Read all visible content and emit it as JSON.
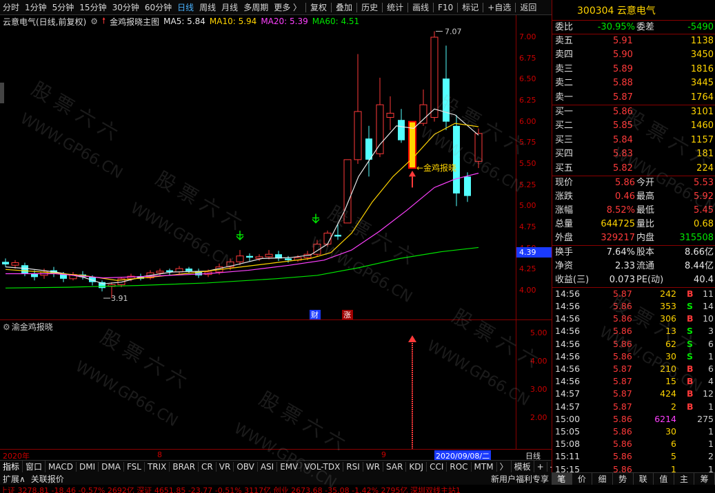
{
  "toolbar": {
    "periods": [
      "分时",
      "1分钟",
      "5分钟",
      "15分钟",
      "30分钟",
      "60分钟",
      "日线",
      "周线",
      "月线",
      "多周期",
      "更多 〉"
    ],
    "active_period": "日线",
    "tools": [
      "复权",
      "叠加",
      "历史",
      "统计",
      "画线",
      "F10",
      "标记",
      "+自选",
      "返回"
    ]
  },
  "chart_header": {
    "stock_label": "云意电气(日线,前复权)",
    "indicator_name": "金鸡报晓主图",
    "ma5": "MA5: 5.84",
    "ma10": "MA10: 5.94",
    "ma20": "MA20: 5.39",
    "ma60": "MA60: 4.51"
  },
  "price_axis": [
    "7.00",
    "6.75",
    "6.50",
    "6.25",
    "6.00",
    "5.75",
    "5.50",
    "5.25",
    "5.00",
    "4.75",
    "4.50",
    "4.25",
    "4.00"
  ],
  "current_price_tag": "4.39",
  "annotations": {
    "high_label": "7.07",
    "low_label": "3.91",
    "signal_label": "←金鸡报晓",
    "cai": "财",
    "zhang": "涨"
  },
  "sub_chart": {
    "title": "渝金鸡报晓",
    "axis": [
      "5.00",
      "4.00",
      "3.00",
      "2.00"
    ]
  },
  "date_axis": {
    "start": "2020年",
    "m8": "8",
    "m9": "9",
    "cursor_date": "2020/09/08/二",
    "right_label": "日线"
  },
  "indicator_tabs": [
    "指标",
    "窗口",
    "MACD",
    "DMI",
    "DMA",
    "FSL",
    "TRIX",
    "BRAR",
    "CR",
    "VR",
    "OBV",
    "ASI",
    "EMV",
    "VOL-TDX",
    "RSI",
    "WR",
    "SAR",
    "KDJ",
    "CCI",
    "ROC",
    "MTM",
    "〉",
    "模板",
    "+",
    "-"
  ],
  "ext_bar": [
    "扩展∧",
    "关联报价"
  ],
  "ext_bar_right": "新用户福利专享",
  "ticker": "上证 3278.81 -18.46 -0.57% 2692亿   深证 4651.85 -23.77 -0.51% 3117亿   创业 2673.68 -35.08 -1.42% 2795亿   深圳双线主站1",
  "quote": {
    "code_name": "300304 云意电气",
    "weibi_label": "委比",
    "weibi": "-30.95%",
    "weicha_label": "委差",
    "weicha": "-5490",
    "asks": [
      {
        "label": "卖五",
        "price": "5.91",
        "qty": "1138"
      },
      {
        "label": "卖四",
        "price": "5.90",
        "qty": "3450"
      },
      {
        "label": "卖三",
        "price": "5.89",
        "qty": "1816"
      },
      {
        "label": "卖二",
        "price": "5.88",
        "qty": "3445"
      },
      {
        "label": "卖一",
        "price": "5.87",
        "qty": "1764"
      }
    ],
    "bids": [
      {
        "label": "买一",
        "price": "5.86",
        "qty": "3101"
      },
      {
        "label": "买二",
        "price": "5.85",
        "qty": "1460"
      },
      {
        "label": "买三",
        "price": "5.84",
        "qty": "1157"
      },
      {
        "label": "买四",
        "price": "5.83",
        "qty": "181"
      },
      {
        "label": "买五",
        "price": "5.82",
        "qty": "224"
      }
    ],
    "stats1": [
      {
        "l1": "现价",
        "v1": "5.86",
        "c1": "red",
        "l2": "今开",
        "v2": "5.53",
        "c2": "red"
      },
      {
        "l1": "涨跌",
        "v1": "0.46",
        "c1": "red",
        "l2": "最高",
        "v2": "5.92",
        "c2": "red"
      },
      {
        "l1": "涨幅",
        "v1": "8.52%",
        "c1": "red",
        "l2": "最低",
        "v2": "5.45",
        "c2": "red"
      },
      {
        "l1": "总量",
        "v1": "644725",
        "c1": "yellow",
        "l2": "量比",
        "v2": "0.68",
        "c2": "yellow"
      },
      {
        "l1": "外盘",
        "v1": "329217",
        "c1": "red",
        "l2": "内盘",
        "v2": "315508",
        "c2": "green"
      }
    ],
    "stats2": [
      {
        "l1": "换手",
        "v1": "7.64%",
        "c1": "white",
        "l2": "股本",
        "v2": "8.66亿",
        "c2": "white"
      },
      {
        "l1": "净资",
        "v1": "2.33",
        "c1": "white",
        "l2": "流通",
        "v2": "8.44亿",
        "c2": "white"
      },
      {
        "l1": "收益(三)",
        "v1": "0.073",
        "c1": "white",
        "l2": "PE(动)",
        "v2": "40.4",
        "c2": "white"
      }
    ],
    "trades": [
      {
        "t": "14:56",
        "p": "5.87",
        "v": "242",
        "bs": "B",
        "n": "11"
      },
      {
        "t": "14:56",
        "p": "5.86",
        "v": "353",
        "bs": "S",
        "n": "14"
      },
      {
        "t": "14:56",
        "p": "5.86",
        "v": "306",
        "bs": "B",
        "n": "10"
      },
      {
        "t": "14:56",
        "p": "5.86",
        "v": "13",
        "bs": "S",
        "n": "3"
      },
      {
        "t": "14:56",
        "p": "5.86",
        "v": "62",
        "bs": "S",
        "n": "6"
      },
      {
        "t": "14:56",
        "p": "5.86",
        "v": "30",
        "bs": "S",
        "n": "1"
      },
      {
        "t": "14:56",
        "p": "5.87",
        "v": "210",
        "bs": "B",
        "n": "6"
      },
      {
        "t": "14:56",
        "p": "5.87",
        "v": "15",
        "bs": "B",
        "n": "4"
      },
      {
        "t": "14:57",
        "p": "5.87",
        "v": "424",
        "bs": "B",
        "n": "12"
      },
      {
        "t": "14:57",
        "p": "5.87",
        "v": "2",
        "bs": "B",
        "n": "1"
      },
      {
        "t": "15:00",
        "p": "5.86",
        "v": "6214",
        "bs": "",
        "n": "275"
      },
      {
        "t": "15:05",
        "p": "5.86",
        "v": "30",
        "bs": "",
        "n": "1"
      },
      {
        "t": "15:08",
        "p": "5.86",
        "v": "6",
        "bs": "",
        "n": "1"
      },
      {
        "t": "15:11",
        "p": "5.86",
        "v": "5",
        "bs": "",
        "n": "2"
      },
      {
        "t": "15:15",
        "p": "5.86",
        "v": "1",
        "bs": "",
        "n": "1"
      }
    ],
    "tabs": [
      "笔",
      "价",
      "细",
      "势",
      "联",
      "值",
      "主",
      "筹"
    ]
  },
  "watermark": [
    "股 票 六 六",
    "WWW.GP66.CN"
  ]
}
